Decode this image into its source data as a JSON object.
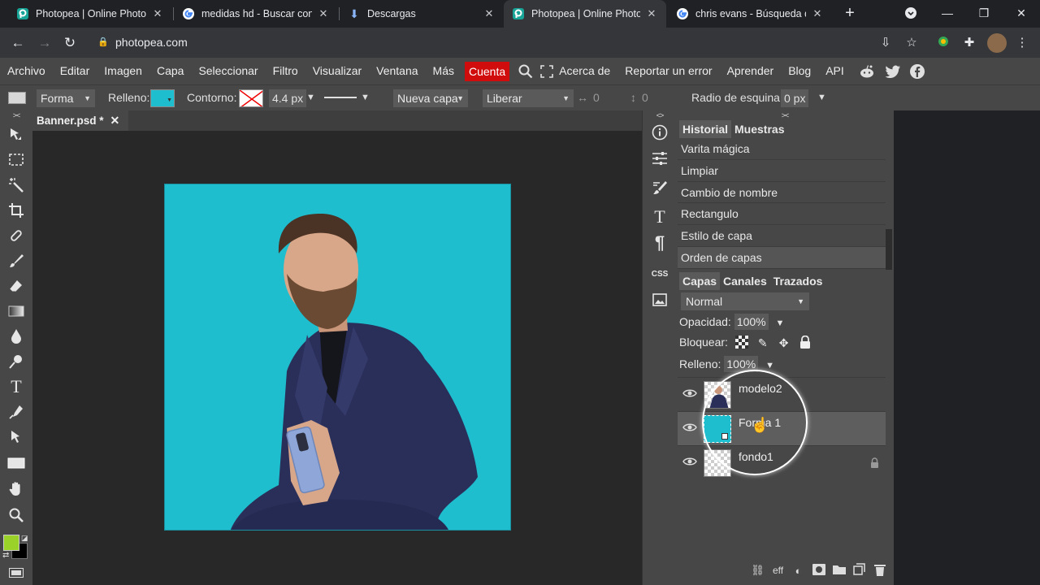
{
  "browser": {
    "tabs": [
      {
        "title": "Photopea | Online Photo E",
        "icon": "photopea-icon",
        "active": false
      },
      {
        "title": "medidas hd - Buscar con G",
        "icon": "google-icon",
        "active": false
      },
      {
        "title": "Descargas",
        "icon": "download-icon",
        "active": false
      },
      {
        "title": "Photopea | Online Photo E",
        "icon": "photopea-icon",
        "active": true
      },
      {
        "title": "chris evans - Búsqueda de",
        "icon": "google-icon",
        "active": false
      }
    ],
    "url": "photopea.com"
  },
  "menu": {
    "items": [
      "Archivo",
      "Editar",
      "Imagen",
      "Capa",
      "Seleccionar",
      "Filtro",
      "Visualizar",
      "Ventana",
      "Más"
    ],
    "account": "Cuenta",
    "right_items": [
      "Acerca de",
      "Reportar un error",
      "Aprender",
      "Blog",
      "API"
    ]
  },
  "options": {
    "mode": "Forma",
    "fill_label": "Relleno:",
    "fill_color": "#1fbece",
    "stroke_label": "Contorno:",
    "stroke_width": "4.4 px",
    "layer_mode": "Nueva capa",
    "align": "Liberar",
    "w_value": "0",
    "h_value": "0",
    "radius_label": "Radio de esquina:",
    "radius_value": "0 px"
  },
  "document": {
    "tab_title": "Banner.psd *",
    "canvas_color": "#1fbece"
  },
  "history": {
    "tabs": [
      "Historial",
      "Muestras"
    ],
    "items": [
      "Varita mágica",
      "Limpiar",
      "Cambio de nombre",
      "Rectangulo",
      "Estilo de capa",
      "Orden de capas"
    ]
  },
  "layers_panel": {
    "tabs": [
      "Capas",
      "Canales",
      "Trazados"
    ],
    "blend_mode": "Normal",
    "opacity_label": "Opacidad:",
    "opacity_value": "100%",
    "lock_label": "Bloquear:",
    "fill_label": "Relleno:",
    "fill_value": "100%",
    "layers": [
      {
        "name": "modelo2",
        "selected": false,
        "locked": false
      },
      {
        "name": "Forma 1",
        "selected": true,
        "locked": false
      },
      {
        "name": "fondo1",
        "selected": false,
        "locked": true
      }
    ],
    "bottom_icons": [
      "link-icon",
      "eff",
      "adjustment-icon",
      "mask-icon",
      "folder-icon",
      "new-layer-icon",
      "trash-icon"
    ],
    "eff_label": "eff"
  },
  "colors": {
    "foreground": "#9bd22a",
    "background": "#000000",
    "accent": "#d10c0c"
  }
}
